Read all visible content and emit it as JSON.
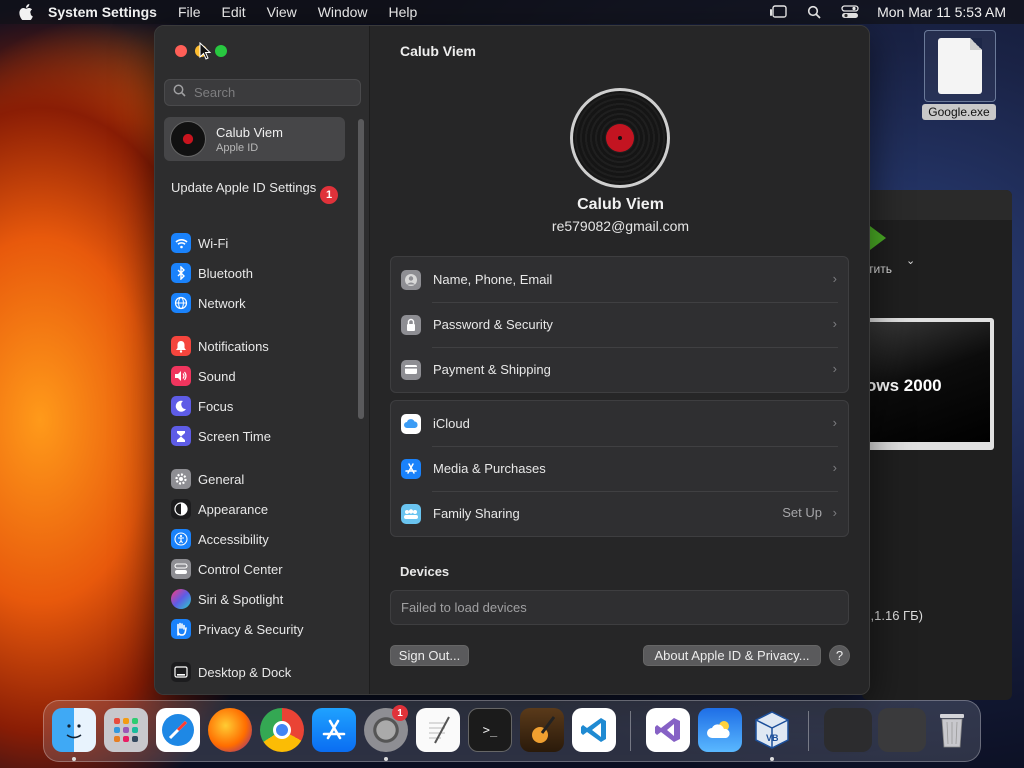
{
  "menubar": {
    "app_name": "System Settings",
    "items": [
      "File",
      "Edit",
      "View",
      "Window",
      "Help"
    ],
    "clock": "Mon Mar 11  5:53 AM"
  },
  "desktop": {
    "file_label": "Google.exe"
  },
  "background_window": {
    "run_label": "стить",
    "preview_text": "ows 2000",
    "size_text": "Б,1.16 ГБ)"
  },
  "sidebar": {
    "search_placeholder": "Search",
    "account": {
      "name": "Calub Viem",
      "subtitle": "Apple ID"
    },
    "update": {
      "label": "Update Apple ID Settings",
      "badge": "1"
    },
    "items": [
      {
        "label": "Wi-Fi",
        "icon": "wifi-icon",
        "color": "#1a82fb"
      },
      {
        "label": "Bluetooth",
        "icon": "bluetooth-icon",
        "color": "#1a82fb"
      },
      {
        "label": "Network",
        "icon": "globe-icon",
        "color": "#1a82fb"
      },
      {
        "label": "Notifications",
        "icon": "bell-icon",
        "color": "#f5453d"
      },
      {
        "label": "Sound",
        "icon": "speaker-icon",
        "color": "#f0355e"
      },
      {
        "label": "Focus",
        "icon": "moon-icon",
        "color": "#5e5ce6"
      },
      {
        "label": "Screen Time",
        "icon": "hourglass-icon",
        "color": "#5e5ce6"
      },
      {
        "label": "General",
        "icon": "gear-icon",
        "color": "#8e8e93"
      },
      {
        "label": "Appearance",
        "icon": "appearance-icon",
        "color": "#1c1c1e"
      },
      {
        "label": "Accessibility",
        "icon": "accessibility-icon",
        "color": "#1a82fb"
      },
      {
        "label": "Control Center",
        "icon": "control-center-icon",
        "color": "#8e8e93"
      },
      {
        "label": "Siri & Spotlight",
        "icon": "siri-icon",
        "color": "#b044e6"
      },
      {
        "label": "Privacy & Security",
        "icon": "hand-icon",
        "color": "#1a82fb"
      },
      {
        "label": "Desktop & Dock",
        "icon": "dock-icon",
        "color": "#1c1c1e"
      }
    ]
  },
  "main": {
    "title": "Calub Viem",
    "user_name": "Calub Viem",
    "user_email": "re579082@gmail.com",
    "group1": [
      {
        "label": "Name, Phone, Email",
        "icon": "person-icon",
        "color": "#8e8e93"
      },
      {
        "label": "Password & Security",
        "icon": "lock-icon",
        "color": "#8e8e93"
      },
      {
        "label": "Payment & Shipping",
        "icon": "card-icon",
        "color": "#8e8e93"
      }
    ],
    "group2": [
      {
        "label": "iCloud",
        "icon": "cloud-icon",
        "color": "#ffffff",
        "value": ""
      },
      {
        "label": "Media & Purchases",
        "icon": "app-store-icon",
        "color": "#1a82fb",
        "value": ""
      },
      {
        "label": "Family Sharing",
        "icon": "family-icon",
        "color": "#6ac4f0",
        "value": "Set Up"
      }
    ],
    "devices_title": "Devices",
    "devices_message": "Failed to load devices",
    "sign_out_label": "Sign Out...",
    "about_label": "About Apple ID & Privacy...",
    "help_label": "?"
  },
  "dock": {
    "apps": [
      {
        "name": "finder-icon",
        "running": true
      },
      {
        "name": "launchpad-icon",
        "running": false
      },
      {
        "name": "safari-icon",
        "running": false
      },
      {
        "name": "firefox-icon",
        "running": false
      },
      {
        "name": "chrome-icon",
        "running": false
      },
      {
        "name": "app-store-icon",
        "running": false
      },
      {
        "name": "system-settings-icon",
        "running": true,
        "badge": "1"
      },
      {
        "name": "textedit-icon",
        "running": false
      },
      {
        "name": "terminal-icon",
        "running": false
      },
      {
        "name": "garageband-icon",
        "running": false
      },
      {
        "name": "vscode-icon",
        "running": false
      },
      {
        "name": "visual-studio-icon",
        "running": false
      },
      {
        "name": "weather-icon",
        "running": false
      },
      {
        "name": "virtualbox-icon",
        "running": true
      },
      {
        "name": "window-thumbnail-icon",
        "running": false
      },
      {
        "name": "window-thumbnail-icon",
        "running": false
      },
      {
        "name": "trash-icon",
        "running": false
      }
    ]
  }
}
